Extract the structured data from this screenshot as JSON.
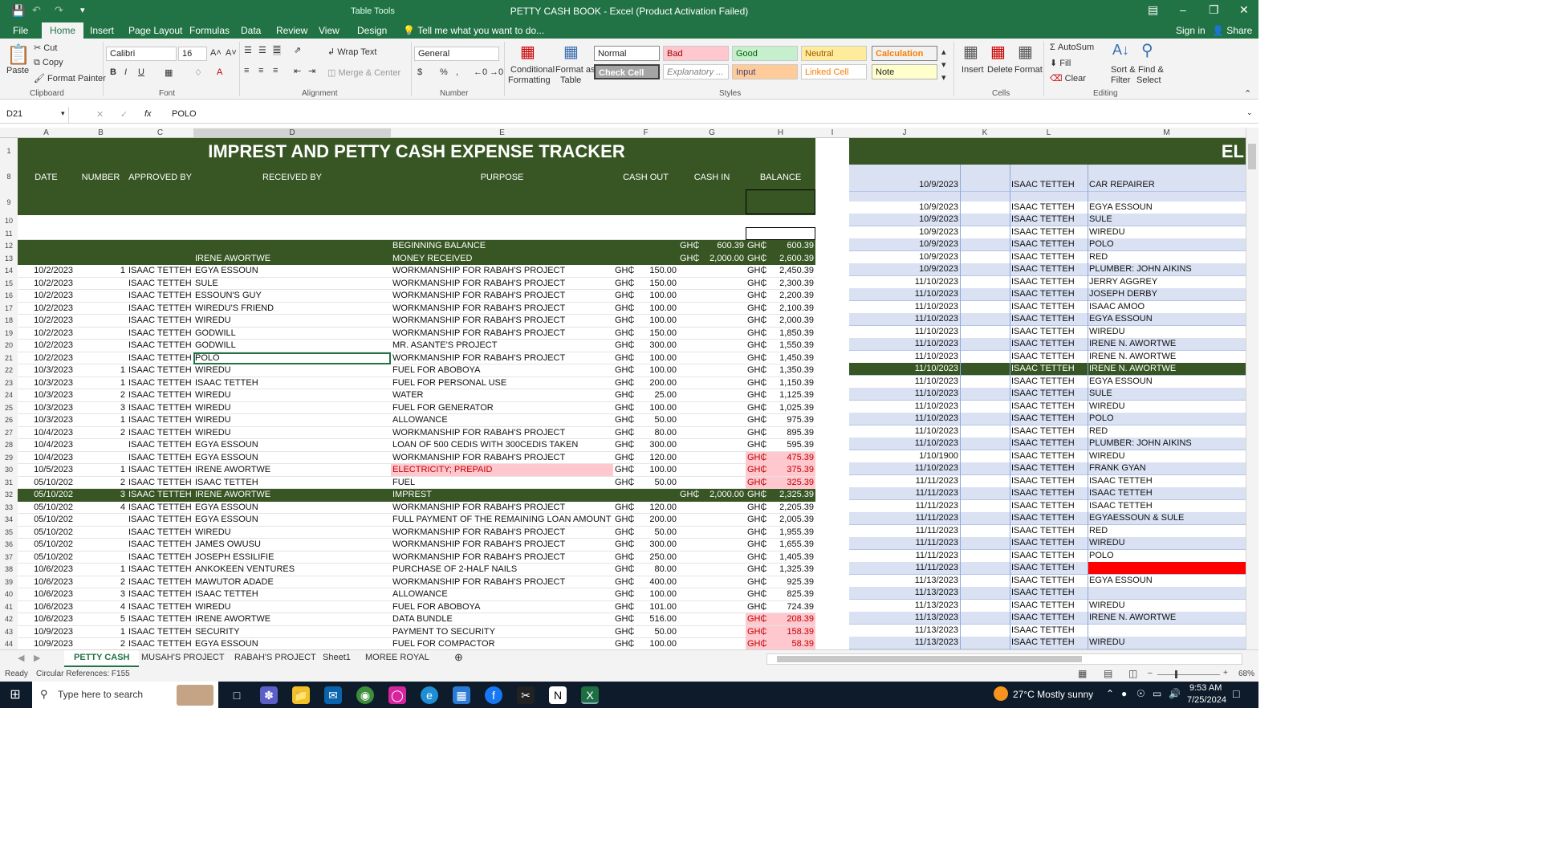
{
  "window": {
    "title": "PETTY CASH BOOK - Excel (Product Activation Failed)",
    "context_tab": "Table Tools"
  },
  "menu": {
    "tabs": [
      "File",
      "Home",
      "Insert",
      "Page Layout",
      "Formulas",
      "Data",
      "Review",
      "View",
      "Design"
    ],
    "tell": "Tell me what you want to do...",
    "signin": "Sign in",
    "share": "Share"
  },
  "ribbon": {
    "paste": "Paste",
    "cut": "Cut",
    "copy": "Copy",
    "format_painter": "Format Painter",
    "clipboard": "Clipboard",
    "font_name": "Calibri",
    "font_size": "16",
    "font": "Font",
    "wrap_text": "Wrap Text",
    "merge_center": "Merge & Center",
    "alignment": "Alignment",
    "number_format": "General",
    "number": "Number",
    "cond_format": "Conditional",
    "cond_format2": "Formatting",
    "format_table": "Format as",
    "format_table2": "Table",
    "styles": "Styles",
    "style_names": [
      "Normal",
      "Bad",
      "Good",
      "Neutral",
      "Calculation",
      "Check Cell",
      "Explanatory ...",
      "Input",
      "Linked Cell",
      "Note"
    ],
    "insert": "Insert",
    "delete": "Delete",
    "format": "Format",
    "cells": "Cells",
    "autosum": "AutoSum",
    "fill": "Fill",
    "clear": "Clear",
    "sort_filter": "Sort &",
    "sort_filter2": "Filter",
    "find_select": "Find &",
    "find_select2": "Select",
    "editing": "Editing"
  },
  "formula": {
    "namebox": "D21",
    "fx": "fx",
    "value": "POLO"
  },
  "columns": [
    "A",
    "B",
    "C",
    "D",
    "E",
    "F",
    "G",
    "H",
    "I",
    "J",
    "K",
    "L",
    "M"
  ],
  "sheet": {
    "title": "IMPREST AND PETTY CASH EXPENSE TRACKER",
    "right_title": "EL",
    "headers": [
      "DATE",
      "NUMBER",
      "APPROVED BY",
      "RECEIVED BY",
      "PURPOSE",
      "CASH OUT",
      "CASH IN",
      "BALANCE"
    ],
    "currency": "GH₵",
    "begin_label": "BEGINNING BALANCE",
    "begin_in": "600.39",
    "begin_bal": "600.39",
    "money_row": {
      "recv": "IRENE AWORTWE",
      "purpose": "MONEY RECEIVED",
      "in": "2,000.00",
      "bal": "2,600.39"
    },
    "rows": [
      {
        "n": "14",
        "date": "10/2/2023",
        "num": "1",
        "app": "ISAAC TETTEH",
        "recv": "EGYA ESSOUN",
        "purpose": "WORKMANSHIP FOR RABAH'S PROJECT",
        "out": "150.00",
        "in": "",
        "bal": "2,450.39"
      },
      {
        "n": "15",
        "date": "10/2/2023",
        "num": "",
        "app": "ISAAC TETTEH",
        "recv": "SULE",
        "purpose": "WORKMANSHIP FOR RABAH'S PROJECT",
        "out": "150.00",
        "in": "",
        "bal": "2,300.39"
      },
      {
        "n": "16",
        "date": "10/2/2023",
        "num": "",
        "app": "ISAAC TETTEH",
        "recv": "ESSOUN'S GUY",
        "purpose": "WORKMANSHIP FOR RABAH'S PROJECT",
        "out": "100.00",
        "in": "",
        "bal": "2,200.39"
      },
      {
        "n": "17",
        "date": "10/2/2023",
        "num": "",
        "app": "ISAAC TETTEH",
        "recv": "WIREDU'S FRIEND",
        "purpose": "WORKMANSHIP FOR RABAH'S PROJECT",
        "out": "100.00",
        "in": "",
        "bal": "2,100.39"
      },
      {
        "n": "18",
        "date": "10/2/2023",
        "num": "",
        "app": "ISAAC TETTEH",
        "recv": "WIREDU",
        "purpose": "WORKMANSHIP FOR RABAH'S PROJECT",
        "out": "100.00",
        "in": "",
        "bal": "2,000.39"
      },
      {
        "n": "19",
        "date": "10/2/2023",
        "num": "",
        "app": "ISAAC TETTEH",
        "recv": "GODWILL",
        "purpose": "WORKMANSHIP FOR RABAH'S PROJECT",
        "out": "150.00",
        "in": "",
        "bal": "1,850.39"
      },
      {
        "n": "20",
        "date": "10/2/2023",
        "num": "",
        "app": "ISAAC TETTEH",
        "recv": "GODWILL",
        "purpose": "MR. ASANTE'S PROJECT",
        "out": "300.00",
        "in": "",
        "bal": "1,550.39"
      },
      {
        "n": "21",
        "date": "10/2/2023",
        "num": "",
        "app": "ISAAC TETTEH",
        "recv": "POLO",
        "purpose": "WORKMANSHIP FOR RABAH'S PROJECT",
        "out": "100.00",
        "in": "",
        "bal": "1,450.39"
      },
      {
        "n": "22",
        "date": "10/3/2023",
        "num": "1",
        "app": "ISAAC TETTEH",
        "recv": "WIREDU",
        "purpose": "FUEL FOR ABOBOYA",
        "out": "100.00",
        "in": "",
        "bal": "1,350.39"
      },
      {
        "n": "23",
        "date": "10/3/2023",
        "num": "1",
        "app": "ISAAC TETTEH",
        "recv": "ISAAC TETTEH",
        "purpose": "FUEL FOR PERSONAL USE",
        "out": "200.00",
        "in": "",
        "bal": "1,150.39"
      },
      {
        "n": "24",
        "date": "10/3/2023",
        "num": "2",
        "app": "ISAAC TETTEH",
        "recv": "WIREDU",
        "purpose": "WATER",
        "out": "25.00",
        "in": "",
        "bal": "1,125.39"
      },
      {
        "n": "25",
        "date": "10/3/2023",
        "num": "3",
        "app": "ISAAC TETTEH",
        "recv": "WIREDU",
        "purpose": "FUEL FOR GENERATOR",
        "out": "100.00",
        "in": "",
        "bal": "1,025.39"
      },
      {
        "n": "26",
        "date": "10/3/2023",
        "num": "1",
        "app": "ISAAC TETTEH",
        "recv": "WIREDU",
        "purpose": "ALLOWANCE",
        "out": "50.00",
        "in": "",
        "bal": "975.39"
      },
      {
        "n": "27",
        "date": "10/4/2023",
        "num": "2",
        "app": "ISAAC TETTEH",
        "recv": "WIREDU",
        "purpose": "WORKMANSHIP FOR RABAH'S PROJECT",
        "out": "80.00",
        "in": "",
        "bal": "895.39"
      },
      {
        "n": "28",
        "date": "10/4/2023",
        "num": "",
        "app": "ISAAC TETTEH",
        "recv": "EGYA ESSOUN",
        "purpose": "LOAN OF 500 CEDIS WITH 300CEDIS TAKEN",
        "out": "300.00",
        "in": "",
        "bal": "595.39"
      },
      {
        "n": "29",
        "date": "10/4/2023",
        "num": "",
        "app": "ISAAC TETTEH",
        "recv": "EGYA ESSOUN",
        "purpose": "WORKMANSHIP FOR RABAH'S PROJECT",
        "out": "120.00",
        "in": "",
        "bal": "475.39",
        "red": true
      },
      {
        "n": "30",
        "date": "10/5/2023",
        "num": "1",
        "app": "ISAAC TETTEH",
        "recv": "IRENE AWORTWE",
        "purpose": "ELECTRICITY; PREPAID",
        "out": "100.00",
        "in": "",
        "bal": "375.39",
        "red": true,
        "pred": true
      },
      {
        "n": "31",
        "date": "05/10/202",
        "num": "2",
        "app": "ISAAC TETTEH",
        "recv": "ISAAC TETTEH",
        "purpose": "FUEL",
        "out": "50.00",
        "in": "",
        "bal": "325.39",
        "red": true
      },
      {
        "n": "32",
        "date": "05/10/202",
        "num": "3",
        "app": "ISAAC TETTEH",
        "recv": "IRENE AWORTWE",
        "purpose": "IMPREST",
        "out": "",
        "in": "2,000.00",
        "bal": "2,325.39",
        "green": true
      },
      {
        "n": "33",
        "date": "05/10/202",
        "num": "4",
        "app": "ISAAC TETTEH",
        "recv": "EGYA ESSOUN",
        "purpose": "WORKMANSHIP FOR RABAH'S PROJECT",
        "out": "120.00",
        "in": "",
        "bal": "2,205.39"
      },
      {
        "n": "34",
        "date": "05/10/202",
        "num": "",
        "app": "ISAAC TETTEH",
        "recv": "EGYA ESSOUN",
        "purpose": "FULL PAYMENT OF THE REMAINING LOAN AMOUNT",
        "out": "200.00",
        "in": "",
        "bal": "2,005.39"
      },
      {
        "n": "35",
        "date": "05/10/202",
        "num": "",
        "app": "ISAAC TETTEH",
        "recv": "WIREDU",
        "purpose": "WORKMANSHIP FOR RABAH'S PROJECT",
        "out": "50.00",
        "in": "",
        "bal": "1,955.39"
      },
      {
        "n": "36",
        "date": "05/10/202",
        "num": "",
        "app": "ISAAC TETTEH",
        "recv": "JAMES OWUSU",
        "purpose": "WORKMANSHIP FOR RABAH'S PROJECT",
        "out": "300.00",
        "in": "",
        "bal": "1,655.39"
      },
      {
        "n": "37",
        "date": "05/10/202",
        "num": "",
        "app": "ISAAC TETTEH",
        "recv": "JOSEPH ESSILIFIE",
        "purpose": "WORKMANSHIP FOR RABAH'S PROJECT",
        "out": "250.00",
        "in": "",
        "bal": "1,405.39"
      },
      {
        "n": "38",
        "date": "10/6/2023",
        "num": "1",
        "app": "ISAAC TETTEH",
        "recv": "ANKOKEEN VENTURES",
        "purpose": "PURCHASE OF 2-HALF NAILS",
        "out": "80.00",
        "in": "",
        "bal": "1,325.39"
      },
      {
        "n": "39",
        "date": "10/6/2023",
        "num": "2",
        "app": "ISAAC TETTEH",
        "recv": "MAWUTOR ADADE",
        "purpose": "WORKMANSHIP FOR RABAH'S PROJECT",
        "out": "400.00",
        "in": "",
        "bal": "925.39"
      },
      {
        "n": "40",
        "date": "10/6/2023",
        "num": "3",
        "app": "ISAAC TETTEH",
        "recv": "ISAAC TETTEH",
        "purpose": "ALLOWANCE",
        "out": "100.00",
        "in": "",
        "bal": "825.39"
      },
      {
        "n": "41",
        "date": "10/6/2023",
        "num": "4",
        "app": "ISAAC TETTEH",
        "recv": "WIREDU",
        "purpose": "FUEL FOR ABOBOYA",
        "out": "101.00",
        "in": "",
        "bal": "724.39"
      },
      {
        "n": "42",
        "date": "10/6/2023",
        "num": "5",
        "app": "ISAAC TETTEH",
        "recv": "IRENE AWORTWE",
        "purpose": "DATA BUNDLE",
        "out": "516.00",
        "in": "",
        "bal": "208.39",
        "red": true
      },
      {
        "n": "43",
        "date": "10/9/2023",
        "num": "1",
        "app": "ISAAC TETTEH",
        "recv": "SECURITY",
        "purpose": "PAYMENT TO SECURITY",
        "out": "50.00",
        "in": "",
        "bal": "158.39",
        "red": true
      },
      {
        "n": "44",
        "date": "10/9/2023",
        "num": "2",
        "app": "ISAAC TETTEH",
        "recv": "EGYA ESSOUN",
        "purpose": "FUEL FOR COMPACTOR",
        "out": "100.00",
        "in": "",
        "bal": "58.39",
        "red": true
      }
    ],
    "right_rows": [
      {
        "date": "10/9/2023",
        "app": "ISAAC TETTEH",
        "recv": "CAR REPAIRER"
      },
      {
        "date": "10/9/2023",
        "app": "ISAAC TETTEH",
        "recv": "EGYA ESSOUN"
      },
      {
        "date": "10/9/2023",
        "app": "ISAAC TETTEH",
        "recv": "SULE"
      },
      {
        "date": "10/9/2023",
        "app": "ISAAC TETTEH",
        "recv": "WIREDU"
      },
      {
        "date": "10/9/2023",
        "app": "ISAAC TETTEH",
        "recv": "POLO"
      },
      {
        "date": "10/9/2023",
        "app": "ISAAC TETTEH",
        "recv": "RED"
      },
      {
        "date": "10/9/2023",
        "app": "ISAAC TETTEH",
        "recv": "PLUMBER: JOHN AIKINS"
      },
      {
        "date": "11/10/2023",
        "app": "ISAAC TETTEH",
        "recv": "JERRY AGGREY"
      },
      {
        "date": "11/10/2023",
        "app": "ISAAC TETTEH",
        "recv": "JOSEPH DERBY"
      },
      {
        "date": "11/10/2023",
        "app": "ISAAC TETTEH",
        "recv": "ISAAC AMOO"
      },
      {
        "date": "11/10/2023",
        "app": "ISAAC TETTEH",
        "recv": " EGYA ESSOUN"
      },
      {
        "date": "11/10/2023",
        "app": "ISAAC TETTEH",
        "recv": "WIREDU"
      },
      {
        "date": "11/10/2023",
        "app": "ISAAC TETTEH",
        "recv": "IRENE N. AWORTWE"
      },
      {
        "date": "11/10/2023",
        "app": "ISAAC TETTEH",
        "recv": "IRENE N. AWORTWE"
      },
      {
        "date": "11/10/2023",
        "app": "ISAAC TETTEH",
        "recv": "IRENE N. AWORTWE",
        "green": true
      },
      {
        "date": "11/10/2023",
        "app": "ISAAC TETTEH",
        "recv": "EGYA ESSOUN"
      },
      {
        "date": "11/10/2023",
        "app": "ISAAC TETTEH",
        "recv": "SULE"
      },
      {
        "date": "11/10/2023",
        "app": "ISAAC TETTEH",
        "recv": "WIREDU"
      },
      {
        "date": "11/10/2023",
        "app": "ISAAC TETTEH",
        "recv": "POLO"
      },
      {
        "date": "11/10/2023",
        "app": "ISAAC TETTEH",
        "recv": "RED"
      },
      {
        "date": "11/10/2023",
        "app": "ISAAC TETTEH",
        "recv": "PLUMBER: JOHN AIKINS"
      },
      {
        "date": "1/10/1900",
        "app": "ISAAC TETTEH",
        "recv": "WIREDU"
      },
      {
        "date": "11/10/2023",
        "app": "ISAAC TETTEH",
        "recv": "FRANK GYAN"
      },
      {
        "date": "11/11/2023",
        "app": "ISAAC TETTEH",
        "recv": "ISAAC TETTEH"
      },
      {
        "date": "11/11/2023",
        "app": "ISAAC TETTEH",
        "recv": "ISAAC TETTEH"
      },
      {
        "date": "11/11/2023",
        "app": "ISAAC TETTEH",
        "recv": "ISAAC TETTEH"
      },
      {
        "date": "11/11/2023",
        "app": "ISAAC TETTEH",
        "recv": "EGYAESSOUN & SULE"
      },
      {
        "date": "11/11/2023",
        "app": "ISAAC TETTEH",
        "recv": "RED"
      },
      {
        "date": "11/11/2023",
        "app": "ISAAC TETTEH",
        "recv": "WIREDU"
      },
      {
        "date": "11/11/2023",
        "app": "ISAAC TETTEH",
        "recv": "POLO"
      },
      {
        "date": "11/11/2023",
        "app": "ISAAC TETTEH",
        "recv": "",
        "redfill": true
      },
      {
        "date": "11/13/2023",
        "app": "ISAAC TETTEH",
        "recv": "EGYA ESSOUN"
      },
      {
        "date": "11/13/2023",
        "app": "ISAAC TETTEH",
        "recv": ""
      },
      {
        "date": "11/13/2023",
        "app": "ISAAC TETTEH",
        "recv": "WIREDU"
      },
      {
        "date": "11/13/2023",
        "app": "ISAAC TETTEH",
        "recv": "IRENE N. AWORTWE"
      },
      {
        "date": "11/13/2023",
        "app": "ISAAC TETTEH",
        "recv": ""
      },
      {
        "date": "11/13/2023",
        "app": "ISAAC TETTEH",
        "recv": "WIREDU"
      }
    ]
  },
  "tabs": [
    "PETTY CASH",
    "MUSAH'S PROJECT",
    "RABAH'S PROJECT",
    "Sheet1",
    "MOREE ROYAL"
  ],
  "status": {
    "ready": "Ready",
    "circ": "Circular References: F155",
    "zoom": "68%"
  },
  "taskbar": {
    "search": "Type here to search",
    "weather": "27°C  Mostly sunny",
    "time": "9:53 AM",
    "date": "7/25/2024"
  }
}
